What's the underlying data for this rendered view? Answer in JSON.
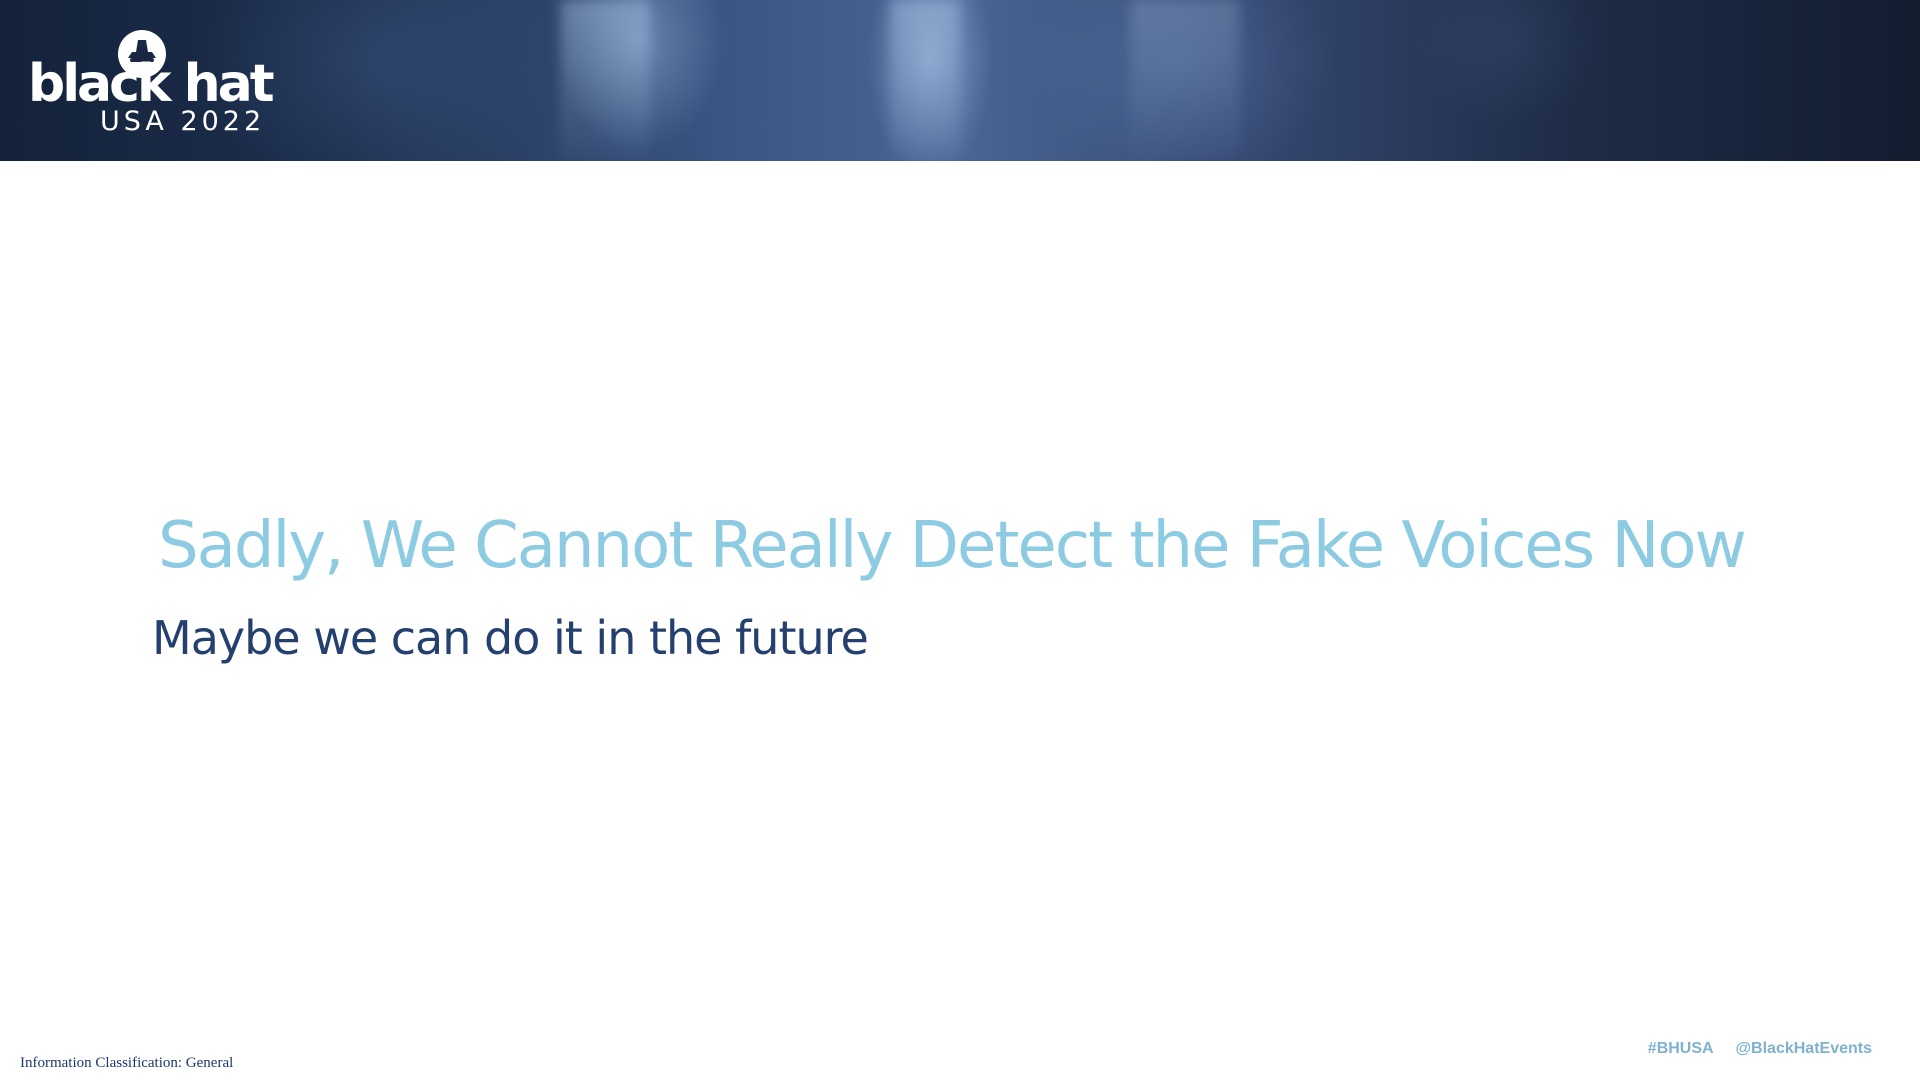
{
  "header": {
    "logo_wordmark": "black hat",
    "logo_event": "USA 2022"
  },
  "slide": {
    "title": "Sadly, We Cannot Really Detect the Fake Voices Now",
    "subtitle": "Maybe we can do it in the future"
  },
  "footer": {
    "classification": "Information Classification: General",
    "hashtag": "#BHUSA",
    "handle": "@BlackHatEvents"
  },
  "colors": {
    "title": "#8ccbe2",
    "subtitle": "#24406e",
    "footer_tags": "#7fb2cf",
    "banner_dark": "#14223a",
    "banner_light": "#4a6594"
  },
  "icons": {
    "logo": "black-hat-logo-icon"
  }
}
